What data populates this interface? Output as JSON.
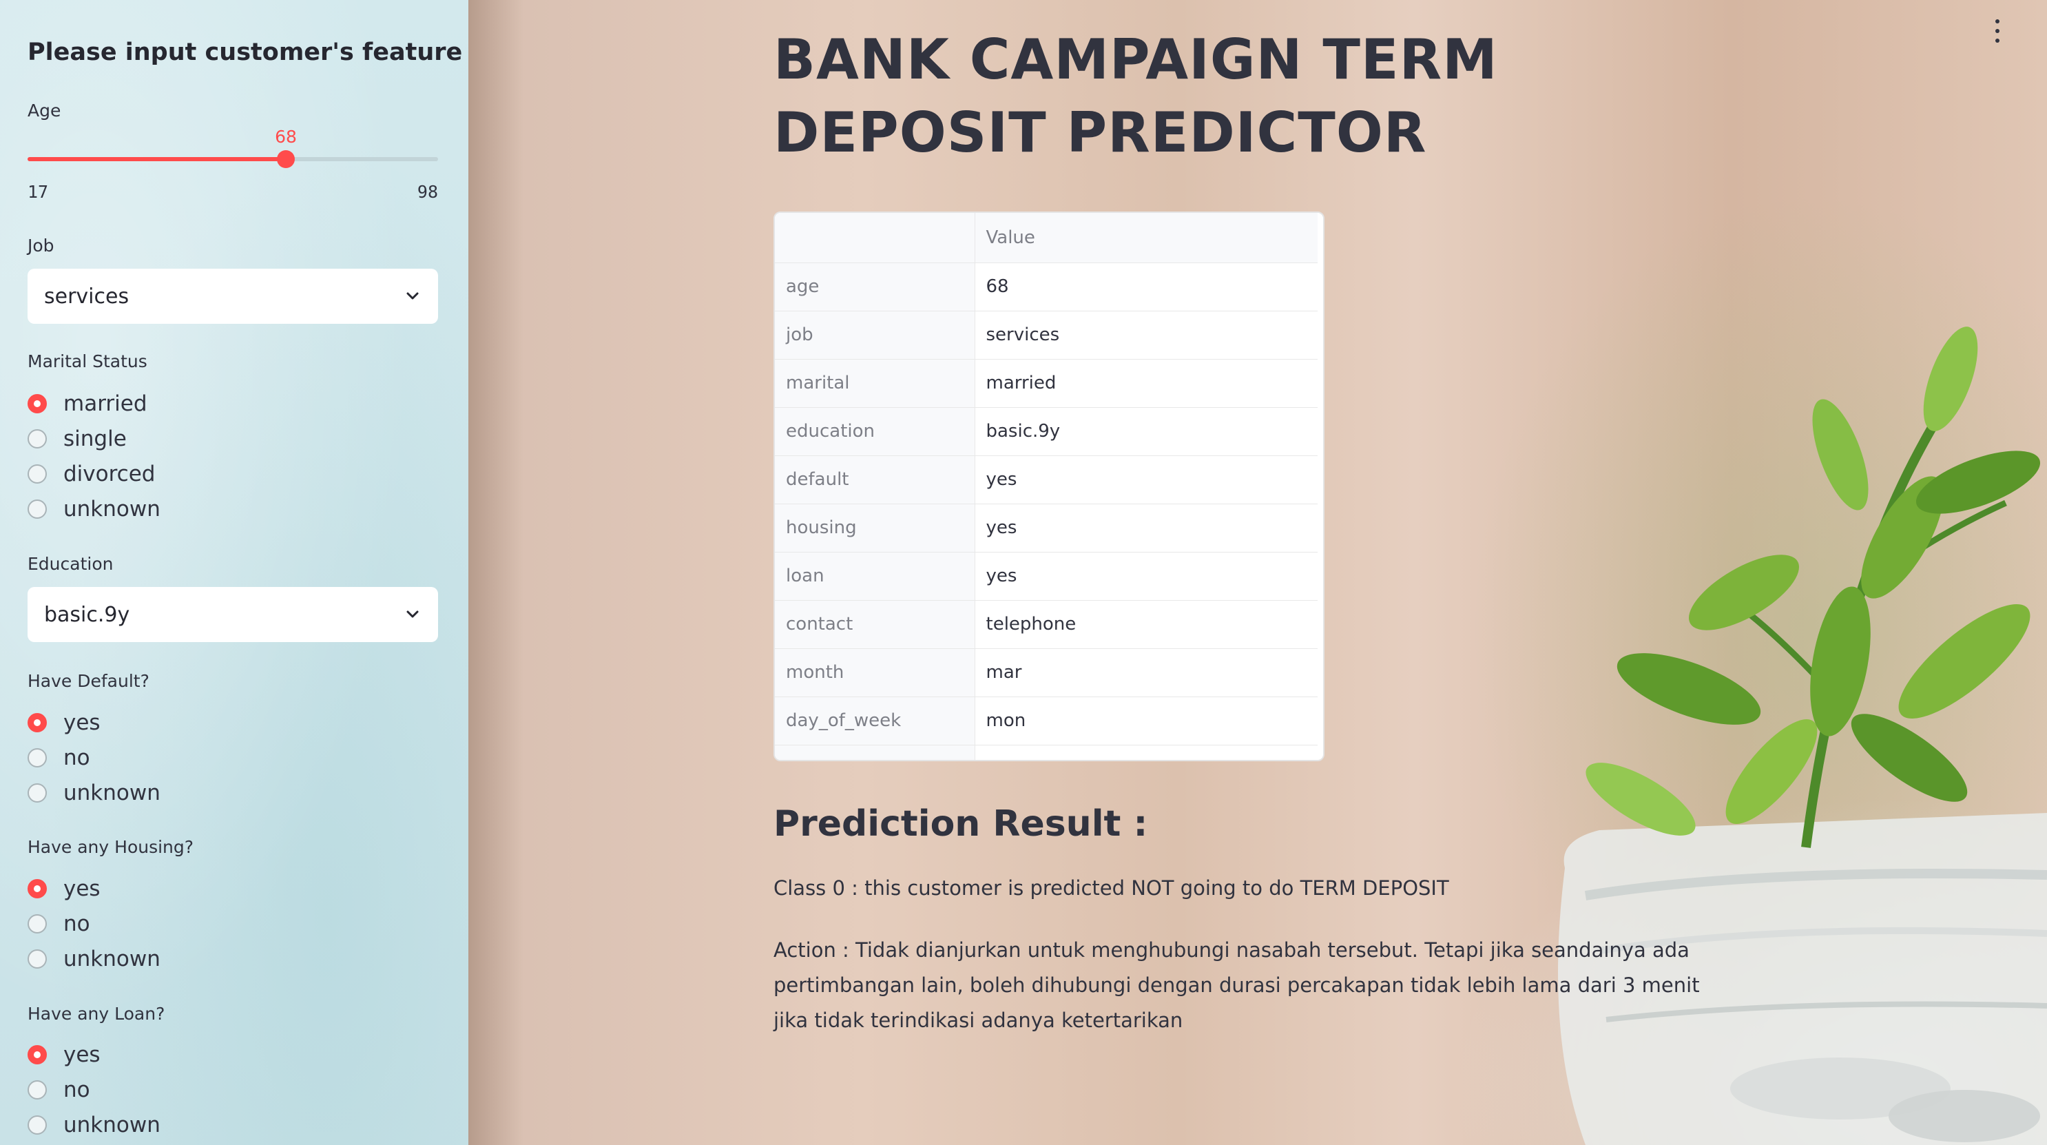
{
  "sidebar": {
    "title": "Please input customer's feature",
    "age": {
      "label": "Age",
      "value": 68,
      "min": 17,
      "max": 98,
      "value_text": "68",
      "min_text": "17",
      "max_text": "98"
    },
    "job": {
      "label": "Job",
      "selected": "services"
    },
    "marital": {
      "label": "Marital Status",
      "options": [
        "married",
        "single",
        "divorced",
        "unknown"
      ],
      "selected": "married"
    },
    "education": {
      "label": "Education",
      "selected": "basic.9y"
    },
    "default": {
      "label": "Have Default?",
      "options": [
        "yes",
        "no",
        "unknown"
      ],
      "selected": "yes"
    },
    "housing": {
      "label": "Have any Housing?",
      "options": [
        "yes",
        "no",
        "unknown"
      ],
      "selected": "yes"
    },
    "loan": {
      "label": "Have any Loan?",
      "options": [
        "yes",
        "no",
        "unknown"
      ],
      "selected": "yes"
    }
  },
  "main": {
    "title": "BANK CAMPAIGN TERM DEPOSIT PREDICTOR",
    "table": {
      "header_index": "",
      "header_value": "Value",
      "rows": [
        [
          "age",
          "68"
        ],
        [
          "job",
          "services"
        ],
        [
          "marital",
          "married"
        ],
        [
          "education",
          "basic.9y"
        ],
        [
          "default",
          "yes"
        ],
        [
          "housing",
          "yes"
        ],
        [
          "loan",
          "yes"
        ],
        [
          "contact",
          "telephone"
        ],
        [
          "month",
          "mar"
        ],
        [
          "day_of_week",
          "mon"
        ]
      ]
    },
    "result_title": "Prediction Result :",
    "result_class": "Class 0 : this customer is predicted NOT going to do TERM DEPOSIT",
    "result_action": "Action : Tidak dianjurkan untuk menghubungi nasabah tersebut. Tetapi jika seandainya ada pertimbangan lain, boleh dihubungi dengan durasi percakapan tidak lebih lama dari 3 menit jika tidak terindikasi adanya ketertarikan"
  },
  "colors": {
    "accent": "#ff4b4b",
    "sidebar_bg": "#cfe6ea",
    "text": "#31333f"
  }
}
